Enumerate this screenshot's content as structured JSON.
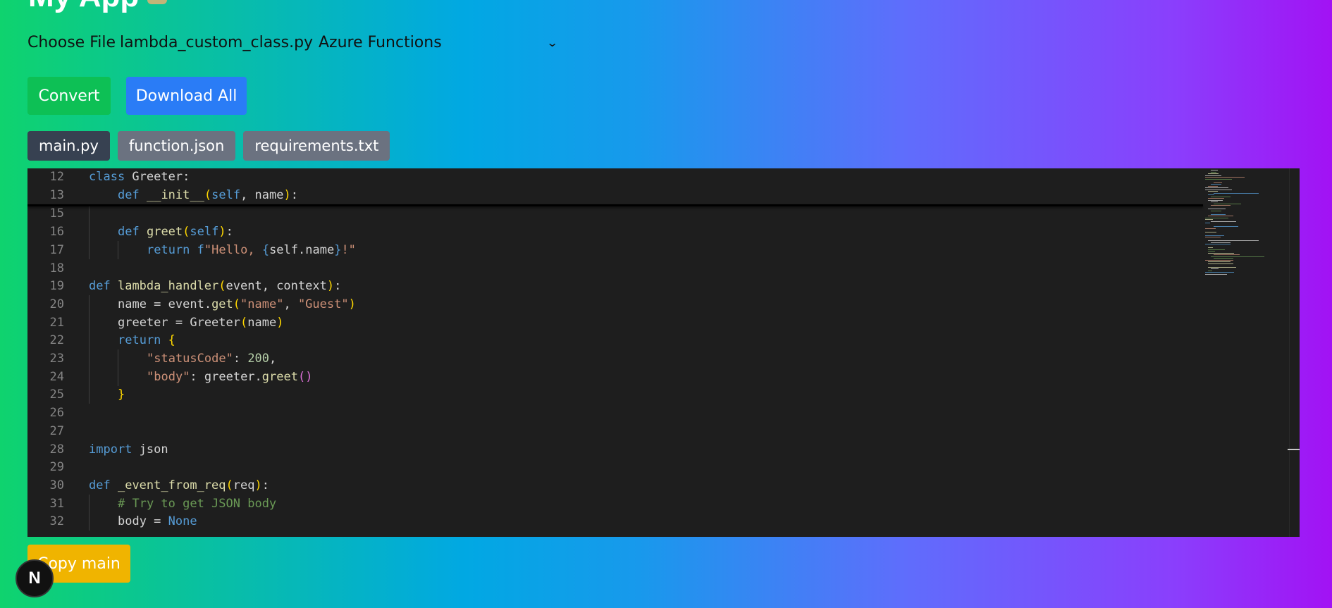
{
  "header": {
    "title_partial": "My App"
  },
  "file_input": {
    "button_label": "Choose File",
    "file_name": "lambda_custom_class.py"
  },
  "target_select": {
    "selected": "Azure Functions"
  },
  "actions": {
    "convert_label": "Convert",
    "download_all_label": "Download All",
    "copy_label": "Copy main"
  },
  "tabs": [
    {
      "label": "main.py",
      "active": true
    },
    {
      "label": "function.json",
      "active": false
    },
    {
      "label": "requirements.txt",
      "active": false
    }
  ],
  "editor": {
    "lines": [
      {
        "n": "12",
        "indent": 0,
        "tokens": [
          [
            "kw",
            "class"
          ],
          [
            "t",
            " Greeter:"
          ]
        ]
      },
      {
        "n": "13",
        "indent": 1,
        "tokens": [
          [
            "kw",
            "def"
          ],
          [
            "t",
            " "
          ],
          [
            "fn",
            "__init__"
          ],
          [
            "p1",
            "("
          ],
          [
            "kw",
            "self"
          ],
          [
            "t",
            ", name"
          ],
          [
            "p1",
            ")"
          ],
          [
            "t",
            ":"
          ]
        ]
      },
      {
        "n": "15",
        "indent": 1,
        "tokens": []
      },
      {
        "n": "16",
        "indent": 1,
        "tokens": [
          [
            "kw",
            "def"
          ],
          [
            "t",
            " "
          ],
          [
            "fn",
            "greet"
          ],
          [
            "p1",
            "("
          ],
          [
            "kw",
            "self"
          ],
          [
            "p1",
            ")"
          ],
          [
            "t",
            ":"
          ]
        ]
      },
      {
        "n": "17",
        "indent": 2,
        "tokens": [
          [
            "kw",
            "return"
          ],
          [
            "t",
            " "
          ],
          [
            "kw",
            "f"
          ],
          [
            "str",
            "\"Hello, "
          ],
          [
            "kw",
            "{"
          ],
          [
            "t",
            "self.name"
          ],
          [
            "kw",
            "}"
          ],
          [
            "str",
            "!\""
          ]
        ]
      },
      {
        "n": "18",
        "indent": 0,
        "tokens": []
      },
      {
        "n": "19",
        "indent": 0,
        "tokens": [
          [
            "kw",
            "def"
          ],
          [
            "t",
            " "
          ],
          [
            "fn",
            "lambda_handler"
          ],
          [
            "p1",
            "("
          ],
          [
            "t",
            "event, context"
          ],
          [
            "p1",
            ")"
          ],
          [
            "t",
            ":"
          ]
        ]
      },
      {
        "n": "20",
        "indent": 1,
        "tokens": [
          [
            "t",
            "name = event."
          ],
          [
            "fn",
            "get"
          ],
          [
            "p1",
            "("
          ],
          [
            "str",
            "\"name\""
          ],
          [
            "t",
            ", "
          ],
          [
            "str",
            "\"Guest\""
          ],
          [
            "p1",
            ")"
          ]
        ]
      },
      {
        "n": "21",
        "indent": 1,
        "tokens": [
          [
            "t",
            "greeter = Greeter"
          ],
          [
            "p1",
            "("
          ],
          [
            "t",
            "name"
          ],
          [
            "p1",
            ")"
          ]
        ]
      },
      {
        "n": "22",
        "indent": 1,
        "tokens": [
          [
            "kw",
            "return"
          ],
          [
            "t",
            " "
          ],
          [
            "p1",
            "{"
          ]
        ]
      },
      {
        "n": "23",
        "indent": 2,
        "tokens": [
          [
            "str",
            "\"statusCode\""
          ],
          [
            "t",
            ": "
          ],
          [
            "num",
            "200"
          ],
          [
            "t",
            ","
          ]
        ]
      },
      {
        "n": "24",
        "indent": 2,
        "tokens": [
          [
            "str",
            "\"body\""
          ],
          [
            "t",
            ": greeter."
          ],
          [
            "fn",
            "greet"
          ],
          [
            "p2",
            "()"
          ]
        ]
      },
      {
        "n": "25",
        "indent": 1,
        "tokens": [
          [
            "p1",
            "}"
          ]
        ]
      },
      {
        "n": "26",
        "indent": 0,
        "tokens": []
      },
      {
        "n": "27",
        "indent": 0,
        "tokens": []
      },
      {
        "n": "28",
        "indent": 0,
        "tokens": [
          [
            "kw",
            "import"
          ],
          [
            "t",
            " json"
          ]
        ]
      },
      {
        "n": "29",
        "indent": 0,
        "tokens": []
      },
      {
        "n": "30",
        "indent": 0,
        "tokens": [
          [
            "kw",
            "def"
          ],
          [
            "t",
            " "
          ],
          [
            "fn",
            "_event_from_req"
          ],
          [
            "p1",
            "("
          ],
          [
            "t",
            "req"
          ],
          [
            "p1",
            ")"
          ],
          [
            "t",
            ":"
          ]
        ]
      },
      {
        "n": "31",
        "indent": 1,
        "tokens": [
          [
            "cmt",
            "# Try to get JSON body"
          ]
        ]
      },
      {
        "n": "32",
        "indent": 1,
        "tokens": [
          [
            "t",
            "body = "
          ],
          [
            "kw",
            "None"
          ]
        ]
      }
    ]
  },
  "badge": {
    "letter": "N"
  },
  "colors": {
    "convert": "#0dc055",
    "download": "#2a7cf6",
    "copy": "#f0b400",
    "editor_bg": "#1e1e1e"
  }
}
